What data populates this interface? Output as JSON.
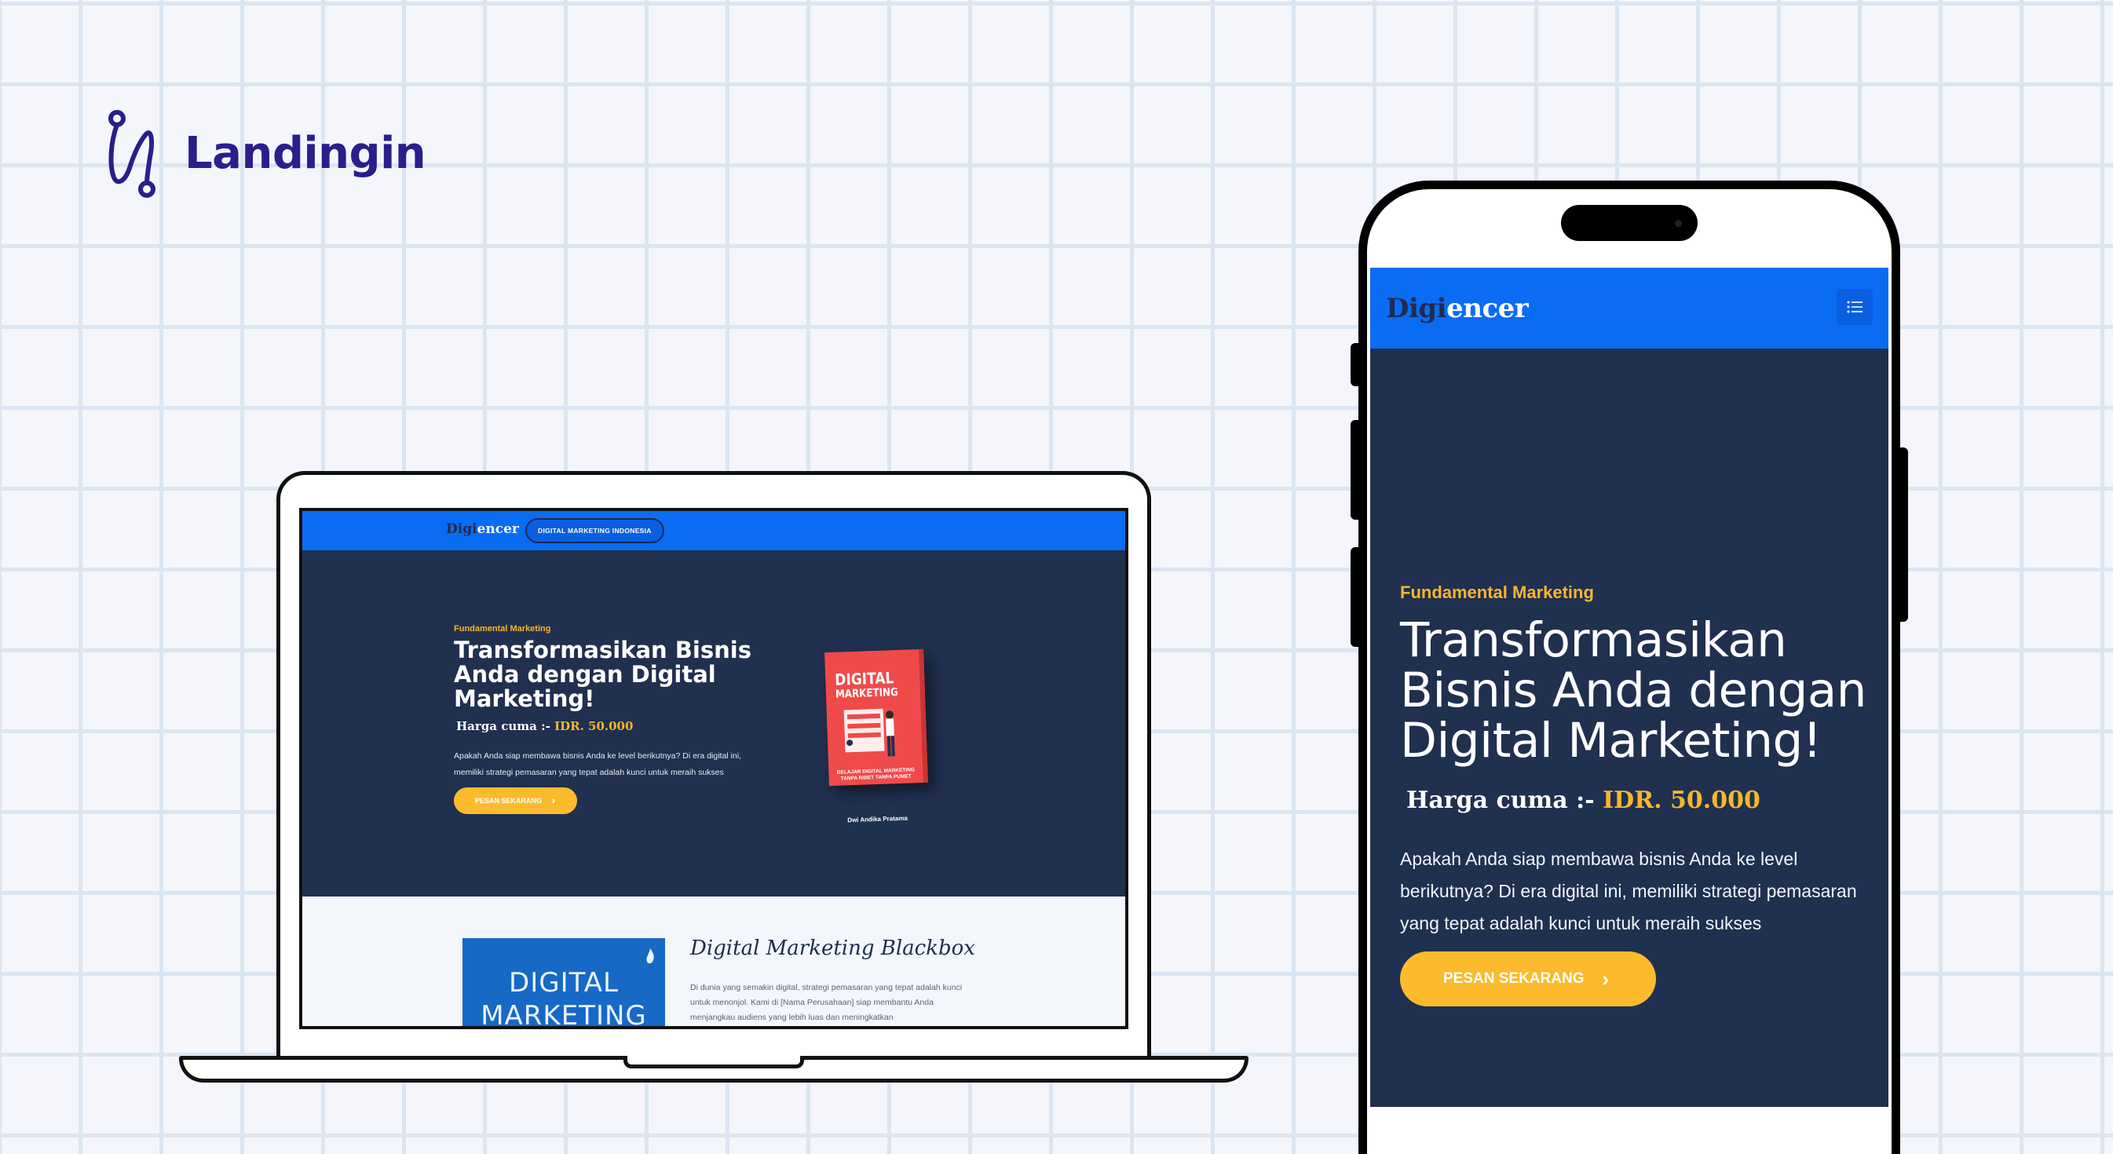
{
  "brand": {
    "name": "Landingin"
  },
  "laptop": {
    "nav": {
      "logo_part1": "Digi",
      "logo_part2": "encer",
      "pill": "DIGITAL MARKETING INDONESIA"
    },
    "hero": {
      "kicker": "Fundamental Marketing",
      "title": "Transformasikan Bisnis Anda dengan Digital Marketing!",
      "price_label": "Harga cuma :-",
      "price_value": "IDR. 50.000",
      "description": "Apakah Anda siap membawa bisnis Anda ke level berikutnya? Di era digital ini, memiliki strategi pemasaran yang tepat adalah kunci untuk meraih sukses",
      "button": "PESAN SEKARANG"
    },
    "book": {
      "title_line1": "DIGITAL",
      "title_line2": "MARKETING",
      "subtitle": "BELAJAR DIGITAL MARKETING TANPA RIBET TANPA PUMET",
      "author": "Dwi Andika Pratama"
    },
    "section2": {
      "image_line1": "DIGITAL",
      "image_line2": "MARKETING",
      "heading": "Digital Marketing Blackbox",
      "paragraph": "Di dunia yang semakin digital, strategi pemasaran yang tepat adalah kunci untuk menonjol. Kami di [Nama Perusahaan] siap membantu Anda menjangkau audiens yang lebih luas dan meningkatkan"
    }
  },
  "phone": {
    "nav": {
      "logo_part1": "Digi",
      "logo_part2": "encer",
      "menu_icon": "list-icon"
    },
    "hero": {
      "kicker": "Fundamental Marketing",
      "title": "Transformasikan Bisnis Anda dengan Digital Marketing!",
      "price_label": "Harga cuma :-",
      "price_value": "IDR. 50.000",
      "description": "Apakah Anda siap membawa bisnis Anda ke level berikutnya? Di era digital ini, memiliki strategi pemasaran yang tepat adalah kunci untuk meraih sukses",
      "button": "PESAN SEKARANG"
    }
  },
  "colors": {
    "brand_purple": "#2b1e8c",
    "nav_blue": "#0a6cf3",
    "hero_navy": "#20304f",
    "accent_yellow": "#fcbb2d",
    "book_red": "#ef4a4a"
  }
}
